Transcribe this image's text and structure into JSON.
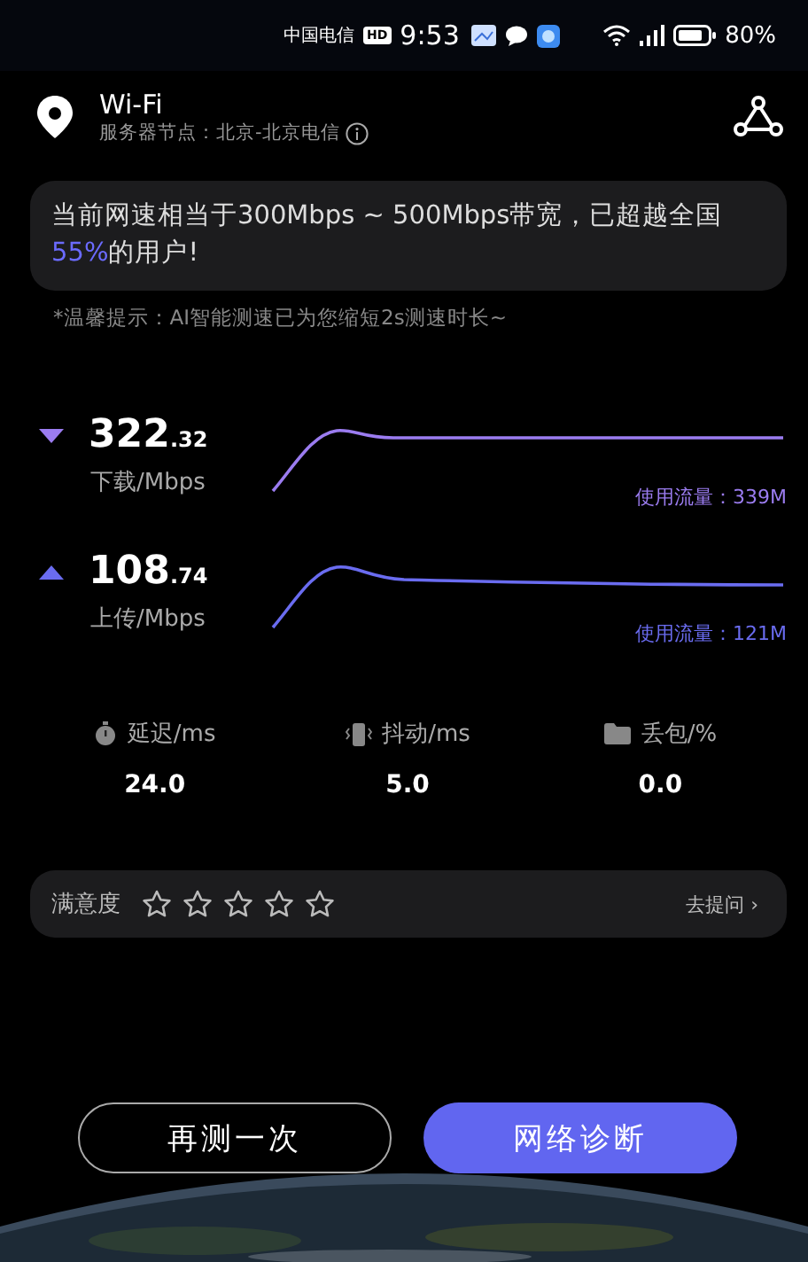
{
  "status_bar": {
    "carrier": "中国电信",
    "hd_badge": "HD",
    "time": "9:53",
    "battery_percent": "80%"
  },
  "header": {
    "network": "Wi-Fi",
    "server": "服务器节点：北京-北京电信"
  },
  "summary": "当前网速相当于300Mbps ~ 500Mbps带宽，已超越全国**55%**的用户!",
  "tip": "*温馨提示：AI智能测速已为您缩短2s测速时长~",
  "speeds": [
    {
      "kind": "download",
      "value": "322",
      "decimal": ".32",
      "unit": "下载/Mbps",
      "usage": "使用流量：339M",
      "color": "#9b7cf0"
    },
    {
      "kind": "upload",
      "value": "108",
      "decimal": ".74",
      "unit": "上传/Mbps",
      "usage": "使用流量：121M",
      "color": "#6a6cf0"
    }
  ],
  "metrics": [
    {
      "kind": "latency",
      "label": "延迟/ms",
      "value": "24.0"
    },
    {
      "kind": "jitter",
      "label": "抖动/ms",
      "value": "5.0"
    },
    {
      "kind": "loss",
      "label": "丢包/%",
      "value": "0.0"
    }
  ],
  "rating": {
    "label": "满意度",
    "stars": 0,
    "link": "去提问 ›"
  },
  "buttons": [
    {
      "label": "再测一次",
      "kind": "secondary"
    },
    {
      "label": "网络诊断",
      "kind": "primary"
    }
  ]
}
